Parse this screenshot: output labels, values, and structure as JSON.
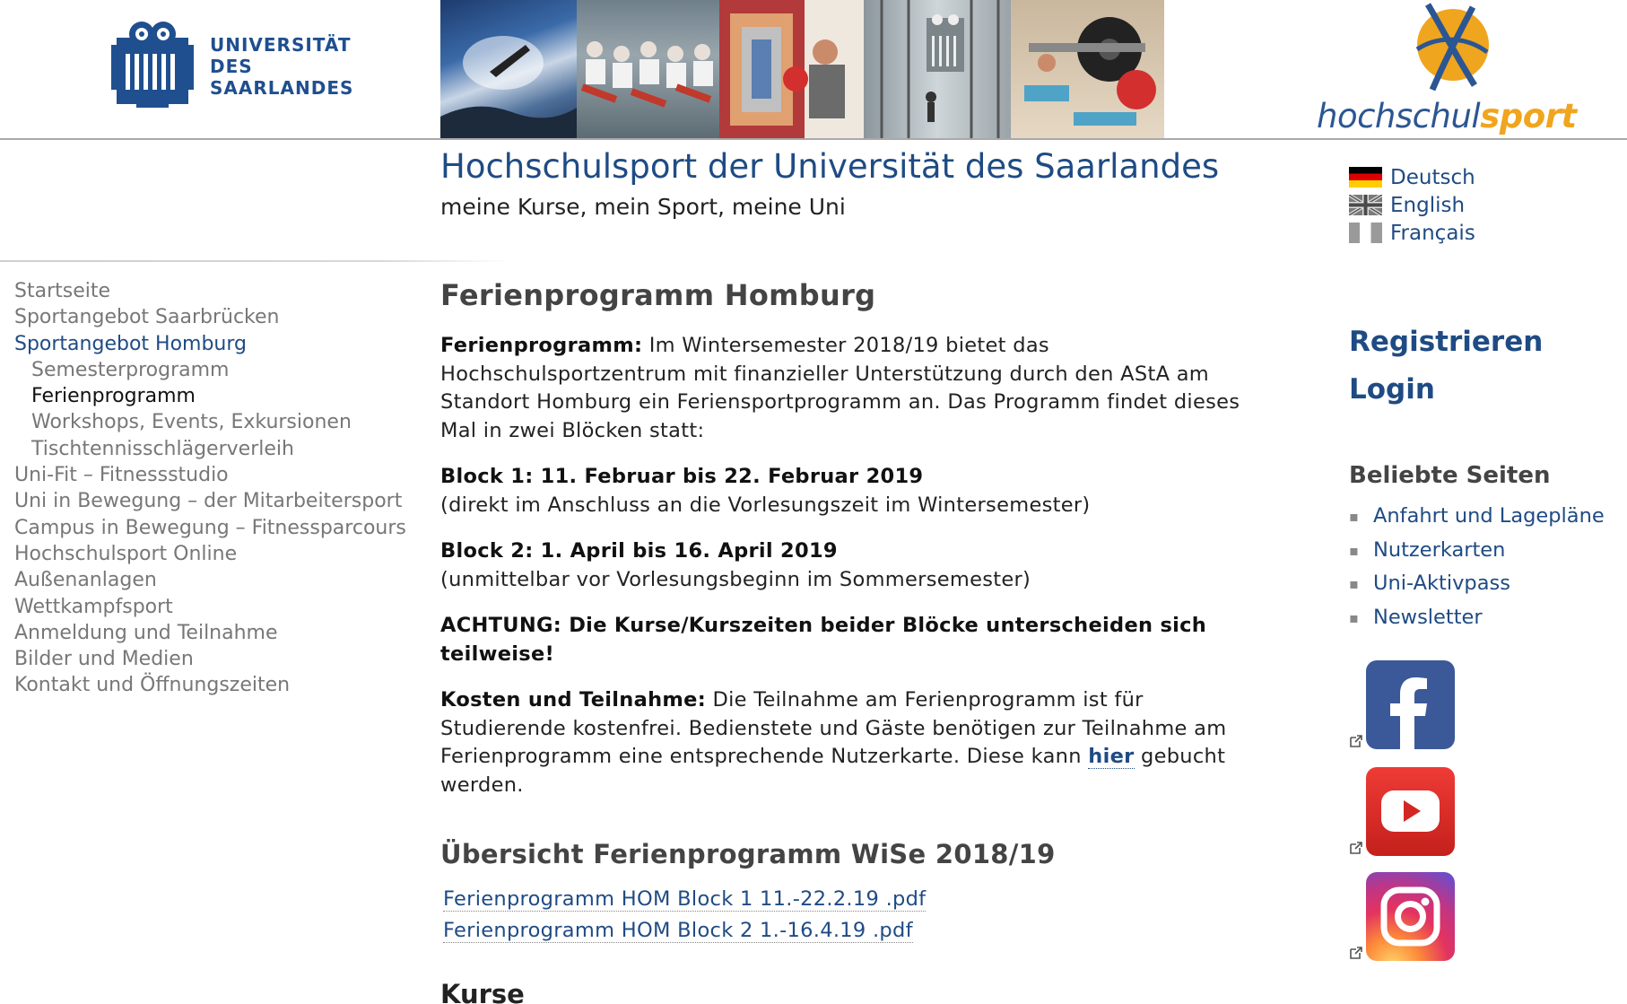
{
  "header": {
    "uni_logo": {
      "line1": "UNIVERSITÄT",
      "line2": "DES",
      "line3": "SAARLANDES",
      "color": "#1f4f8f"
    },
    "hs_logo": {
      "part1": "hochschul",
      "part2": "sport"
    }
  },
  "site": {
    "title": "Hochschulsport der Universität des Saarlandes",
    "subtitle": "meine Kurse, mein Sport, meine Uni"
  },
  "languages": [
    {
      "label": "Deutsch",
      "flag": "flag-de-icon"
    },
    {
      "label": "English",
      "flag": "flag-uk-icon"
    },
    {
      "label": "Français",
      "flag": "flag-fr-icon"
    }
  ],
  "nav": {
    "items": [
      {
        "label": "Startseite"
      },
      {
        "label": "Sportangebot Saarbrücken"
      },
      {
        "label": "Sportangebot Homburg"
      },
      {
        "label": "Semesterprogramm"
      },
      {
        "label": "Ferienprogramm"
      },
      {
        "label": "Workshops, Events, Exkursionen"
      },
      {
        "label": "Tischtennisschlägerverleih"
      },
      {
        "label": "Uni-Fit – Fitnessstudio"
      },
      {
        "label": "Uni in Bewegung – der Mitarbeitersport"
      },
      {
        "label": "Campus in Bewegung – Fitnessparcours"
      },
      {
        "label": "Hochschulsport Online"
      },
      {
        "label": "Außenanlagen"
      },
      {
        "label": "Wettkampfsport"
      },
      {
        "label": "Anmeldung und Teilnahme"
      },
      {
        "label": "Bilder und Medien"
      },
      {
        "label": "Kontakt und Öffnungszeiten"
      }
    ]
  },
  "main": {
    "title": "Ferienprogramm Homburg",
    "intro_label": "Ferienprogramm:",
    "intro_text": " Im Wintersemester 2018/19 bietet das Hochschulsportzentrum mit finanzieller Unterstützung durch den AStA am Standort Homburg ein Feriensportprogramm an. Das Programm findet dieses Mal in zwei Blöcken statt:",
    "block1_title": "Block 1: 11. Februar bis 22. Februar 2019",
    "block1_note": "(direkt im Anschluss an die Vorlesungszeit im Wintersemester)",
    "block2_title": "Block 2: 1. April bis 16. April 2019",
    "block2_note": "(unmittelbar vor Vorlesungsbeginn im Sommersemester)",
    "warning": "ACHTUNG: Die Kurse/Kurszeiten beider Blöcke unterscheiden sich teilweise!",
    "costs_label": "Kosten und Teilnahme:",
    "costs_text_before": " Die Teilnahme am Ferienprogramm ist für Studierende kostenfrei. Bedienstete und Gäste benötigen zur Teilnahme am Ferienprogramm eine entsprechende Nutzerkarte. Diese kann ",
    "costs_link": "hier",
    "costs_text_after": " gebucht werden.",
    "overview_title": "Übersicht Ferienprogramm WiSe 2018/19",
    "pdf_links": [
      {
        "label": "Ferienprogramm HOM Block 1 11.-22.2.19 .pdf"
      },
      {
        "label": "Ferienprogramm HOM Block 2 1.-16.4.19 .pdf"
      }
    ],
    "courses_title": "Kurse"
  },
  "sidebar_right": {
    "register": "Registrieren",
    "login": "Login",
    "popular_title": "Beliebte Seiten",
    "popular": [
      {
        "label": "Anfahrt und Lagepläne"
      },
      {
        "label": "Nutzerkarten"
      },
      {
        "label": "Uni-Aktivpass"
      },
      {
        "label": "Newsletter"
      }
    ],
    "social": [
      {
        "name": "facebook-icon",
        "color": "#3b5998"
      },
      {
        "name": "youtube-icon",
        "color": "#e52d27"
      },
      {
        "name": "instagram-icon",
        "color": "#c13584"
      }
    ]
  },
  "colors": {
    "link": "#1f4b84",
    "nav_gray": "#777777",
    "heading_gray": "#444444",
    "accent_orange": "#f0a51e"
  }
}
